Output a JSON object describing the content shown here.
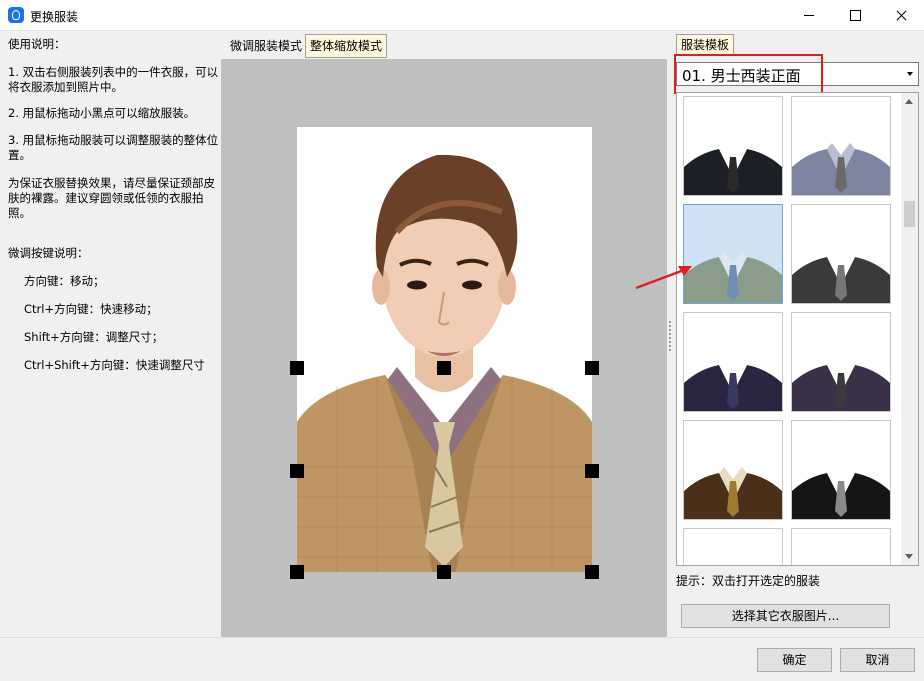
{
  "window": {
    "title": "更换服装"
  },
  "instructions": {
    "title": "使用说明：",
    "step1": "1. 双击右侧服装列表中的一件衣服，可以将衣服添加到照片中。",
    "step2": "2. 用鼠标拖动小黑点可以缩放服装。",
    "step3": "3. 用鼠标拖动服装可以调整服装的整体位置。",
    "note": "为保证衣服替换效果，请尽量保证颈部皮肤的裸露。建议穿圆领或低领的衣服拍照。",
    "keys_title": "微调按键说明：",
    "keys": [
      "方向键：移动；",
      "Ctrl+方向键：快速移动；",
      "Shift+方向键：调整尺寸；",
      "Ctrl+Shift+方向键：快速调整尺寸"
    ]
  },
  "modes": {
    "fine_tune": "微调服装模式",
    "whole_scale": "整体缩放模式"
  },
  "template_panel": {
    "tab": "服装模板",
    "selected": "01. 男士西装正面",
    "thumbnails": [
      {
        "suit": "#1c1f26",
        "shirt": "#ffffff",
        "tie": "#2a2a2a"
      },
      {
        "suit": "#7d86a0",
        "shirt": "#b8bfd2",
        "tie": "#6a6a6a"
      },
      {
        "suit": "#8c9c8a",
        "shirt": "#dfe6ee",
        "tie": "#6f8fb8"
      },
      {
        "suit": "#3a3a3c",
        "shirt": "#ffffff",
        "tie": "#777777"
      },
      {
        "suit": "#2a2540",
        "shirt": "#ffffff",
        "tie": "#3a3a60"
      },
      {
        "suit": "#3a3048",
        "shirt": "#ffffff",
        "tie": "#3a3a3a"
      },
      {
        "suit": "#4a3018",
        "shirt": "#e8dcc0",
        "tie": "#a07a30"
      },
      {
        "suit": "#151515",
        "shirt": "#ffffff",
        "tie": "#8a8a8a"
      },
      {
        "suit": "#3a2a20",
        "shirt": "#ffffff",
        "tie": "#444444"
      },
      {
        "suit": "#5a3020",
        "shirt": "#ffffff",
        "tie": "#444444"
      }
    ],
    "hint": "提示：双击打开选定的服装",
    "other_button": "选择其它衣服图片..."
  },
  "buttons": {
    "ok": "确定",
    "cancel": "取消"
  },
  "colors": {
    "highlight_red": "#e02020",
    "tab_active": "#fff8dc"
  }
}
